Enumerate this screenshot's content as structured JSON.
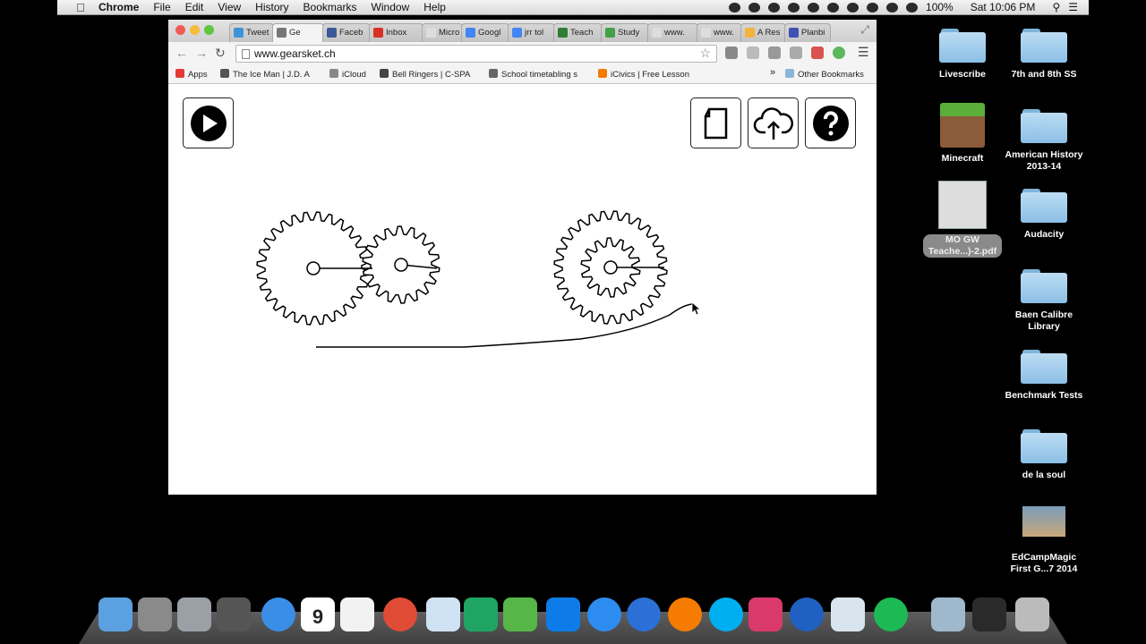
{
  "menubar": {
    "app_name": "Chrome",
    "menus": [
      "File",
      "Edit",
      "View",
      "History",
      "Bookmarks",
      "Window",
      "Help"
    ],
    "battery": "100%",
    "clock": "Sat 10:06 PM"
  },
  "browser": {
    "tabs": [
      {
        "label": "Tweet",
        "color": "#3b94d9"
      },
      {
        "label": "Ge",
        "color": "#777777",
        "active": true
      },
      {
        "label": "Faceb",
        "color": "#3b5998"
      },
      {
        "label": "Inbox",
        "color": "#d93025"
      },
      {
        "label": "Micro",
        "color": "#dddddd"
      },
      {
        "label": "Googl",
        "color": "#4285f4"
      },
      {
        "label": "jrr tol",
        "color": "#4285f4"
      },
      {
        "label": "Teach",
        "color": "#2e7d32"
      },
      {
        "label": "Study",
        "color": "#43a047"
      },
      {
        "label": "www.",
        "color": "#dddddd"
      },
      {
        "label": "www.",
        "color": "#dddddd"
      },
      {
        "label": "A Res",
        "color": "#f2b33d"
      },
      {
        "label": "Planbi",
        "color": "#3f51b5"
      }
    ],
    "url": "www.gearsket.ch",
    "bookmarks": [
      {
        "label": "Apps",
        "color": "#e53935"
      },
      {
        "label": "The Ice Man | J.D. A",
        "color": "#555555"
      },
      {
        "label": "iCloud",
        "color": "#888888"
      },
      {
        "label": "Bell Ringers | C-SPA",
        "color": "#444444"
      },
      {
        "label": "School timetabling s",
        "color": "#666666"
      },
      {
        "label": "iCivics | Free Lesson",
        "color": "#f57c00"
      }
    ],
    "bookmarks_overflow": "»",
    "other_bookmarks": "Other Bookmarks"
  },
  "gearsketch": {
    "play_icon": "play-icon",
    "buttons": [
      "new-document-icon",
      "cloud-upload-icon",
      "help-icon"
    ]
  },
  "desktop": {
    "icons": [
      {
        "label": "Livescribe",
        "type": "folder"
      },
      {
        "label": "7th and 8th SS",
        "type": "folder"
      },
      {
        "label": "Minecraft",
        "type": "app"
      },
      {
        "label": "American History 2013-14",
        "type": "folder"
      },
      {
        "label": "MO GW Teache...)-2.pdf",
        "type": "file"
      },
      {
        "label": "Audacity",
        "type": "folder"
      },
      {
        "label": "Baen Calibre Library",
        "type": "folder"
      },
      {
        "label": "Benchmark Tests",
        "type": "folder"
      },
      {
        "label": "de la soul",
        "type": "folder"
      },
      {
        "label": "EdCampMagic First G...7 2014",
        "type": "image"
      }
    ]
  },
  "dock": {
    "calendar_day": "9",
    "apps": [
      "finder",
      "system-preferences",
      "launchpad",
      "photo-booth",
      "safari",
      "calendar",
      "reminders",
      "chrome",
      "pixelmator",
      "google-drive",
      "evernote",
      "dropbox",
      "app-store",
      "itunes",
      "ibooks",
      "skype",
      "photo-app",
      "quicktime",
      "preview",
      "spotify",
      "downloads",
      "folder",
      "trash"
    ]
  }
}
